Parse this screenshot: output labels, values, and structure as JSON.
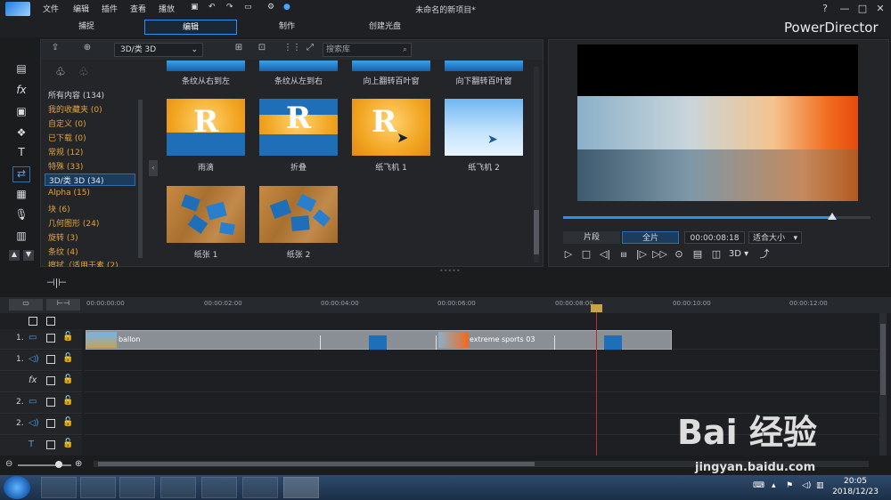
{
  "menu": [
    "文件",
    "编辑",
    "插件",
    "查看",
    "播放"
  ],
  "title": "未命名的新项目*",
  "window_controls": [
    "?",
    "—",
    "□",
    "✕"
  ],
  "modes": [
    "捕捉",
    "编辑",
    "制作",
    "创建光盘"
  ],
  "brand": "PowerDirector",
  "library": {
    "category_select": "3D/类 3D",
    "search_placeholder": "搜索库",
    "categories": [
      "所有内容 (134)",
      "我的收藏夹  (0)",
      "自定义  (0)",
      "已下载  (0)",
      "常规  (12)",
      "特殊  (33)",
      "3D/类 3D  (34)",
      "Alpha  (15)",
      "块  (6)",
      "几何图形  (24)",
      "旋转  (3)",
      "条纹  (4)",
      "擦拭（适用于素  (2)"
    ],
    "selected_index": 6,
    "top_row_labels": [
      "条纹从右到左",
      "条纹从左到右",
      "向上翻转百叶窗",
      "向下翻转百叶窗"
    ],
    "items": [
      {
        "label": "雨滴",
        "letter": "R"
      },
      {
        "label": "折叠",
        "letter": "R"
      },
      {
        "label": "纸飞机 1",
        "letter": "R"
      },
      {
        "label": "纸飞机 2",
        "letter": ""
      },
      {
        "label": "纸张 1",
        "letter": ""
      },
      {
        "label": "纸张 2",
        "letter": ""
      }
    ]
  },
  "preview": {
    "clip_btn": "片段",
    "full_btn": "全片",
    "timecode": "00:00:08:18",
    "fit": "适合大小",
    "threed": "3D"
  },
  "timeline": {
    "ticks": [
      "00:00:00:00",
      "00:00:02:00",
      "00:00:04:00",
      "00:00:06:00",
      "00:00:08:00",
      "00:00:10:00",
      "00:00:12:00"
    ],
    "tracks": [
      {
        "num": "1.",
        "type": "video"
      },
      {
        "num": "1.",
        "type": "audio"
      },
      {
        "num": "",
        "type": "fx"
      },
      {
        "num": "2.",
        "type": "video"
      },
      {
        "num": "2.",
        "type": "audio"
      },
      {
        "num": "",
        "type": "title"
      }
    ],
    "clips": [
      "ballon",
      "extreme sports 03"
    ]
  },
  "taskbar": {
    "time": "20:05",
    "date": "2018/12/23"
  },
  "watermark": {
    "text": "Bai 经验",
    "url": "jingyan.baidu.com"
  }
}
